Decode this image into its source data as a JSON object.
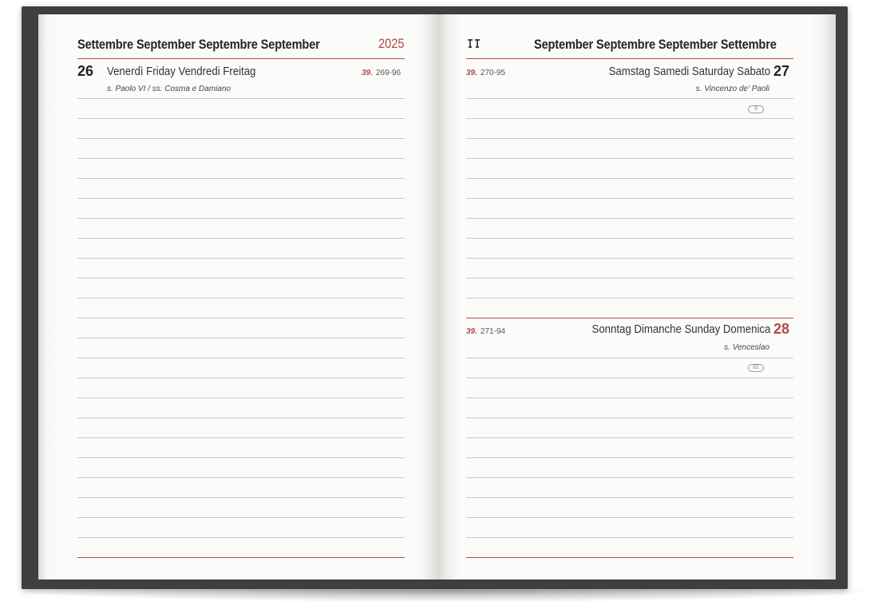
{
  "left_page": {
    "header_title": "Settembre September Septembre September",
    "year": "2025",
    "day_number": "26",
    "day_name": "Venerdì Friday Vendredi Freitag",
    "week_number": "39.",
    "day_code": "269-96",
    "saint": "s. Paolo VI / ss. Cosma e Damiano"
  },
  "right_page": {
    "zodiac_icon": "libra-icon",
    "header_title": "September Septembre September Settembre",
    "day1": {
      "week_number": "39.",
      "day_code": "270-95",
      "day_name": "Samstag Samedi Saturday Sabato",
      "day_number": "27",
      "saint": "s. Vincenzo de' Paoli",
      "moon_badge": "8"
    },
    "day2": {
      "week_number": "39.",
      "day_code": "271-94",
      "day_name": "Sonntag Dimanche Sunday Domenica",
      "day_number": "28",
      "saint": "s. Venceslao",
      "moon_badge": "82"
    }
  },
  "colors": {
    "accent_red": "#b04a48",
    "cover": "#3e3f41"
  }
}
